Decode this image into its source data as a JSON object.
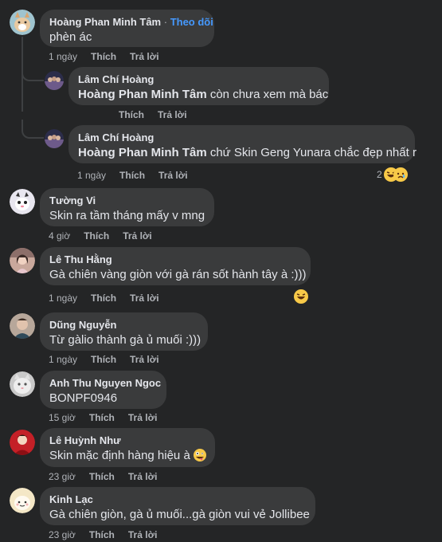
{
  "comments": [
    {
      "name": "Hoàng Phan Minh Tâm",
      "dot": " · ",
      "follow": "Theo dõi",
      "text": "phèn ác",
      "time": "1 ngày",
      "like": "Thích",
      "reply": "Trả lời"
    },
    {
      "name": "Lâm Chí Hoàng",
      "mention": "Hoàng Phan Minh Tâm",
      "text": " còn chưa xem mà bác",
      "time": "",
      "like": "Thích",
      "reply": "Trả lời"
    },
    {
      "name": "Lâm Chí Hoàng",
      "mention": "Hoàng Phan Minh Tâm",
      "text": " chứ Skin Geng Yunara chắc đẹp nhất r",
      "time": "1 ngày",
      "like": "Thích",
      "reply": "Trả lời",
      "reaction_count": "2"
    },
    {
      "name": "Tường Vi",
      "text": "Skin ra tầm tháng mấy v mng",
      "time": "4 giờ",
      "like": "Thích",
      "reply": "Trả lời"
    },
    {
      "name": "Lê Thu Hằng",
      "text": "Gà chiên vàng giòn với gà rán sốt hành tây à :)))",
      "time": "1 ngày",
      "like": "Thích",
      "reply": "Trả lời"
    },
    {
      "name": "Dũng Nguyễn",
      "text": "Từ gàlio thành gà ủ muối :)))",
      "time": "1 ngày",
      "like": "Thích",
      "reply": "Trả lời"
    },
    {
      "name": "Anh Thu Nguyen Ngoc",
      "text": "BONPF0946",
      "time": "15 giờ",
      "like": "Thích",
      "reply": "Trả lời"
    },
    {
      "name": "Lê Huỳnh Như",
      "text": "Skin mặc định hàng hiệu à ",
      "time": "23 giờ",
      "like": "Thích",
      "reply": "Trả lời"
    },
    {
      "name": "Kinh Lạc",
      "text": "Gà chiên giòn, gà ủ muối...gà giòn vui vẻ Jollibee",
      "time": "23 giờ",
      "like": "Thích",
      "reply": "Trả lời"
    }
  ],
  "colors": {
    "background": "#242526",
    "bubble": "#3a3b3c",
    "link": "#4599ff",
    "secondary_text": "#b0b3b8"
  }
}
